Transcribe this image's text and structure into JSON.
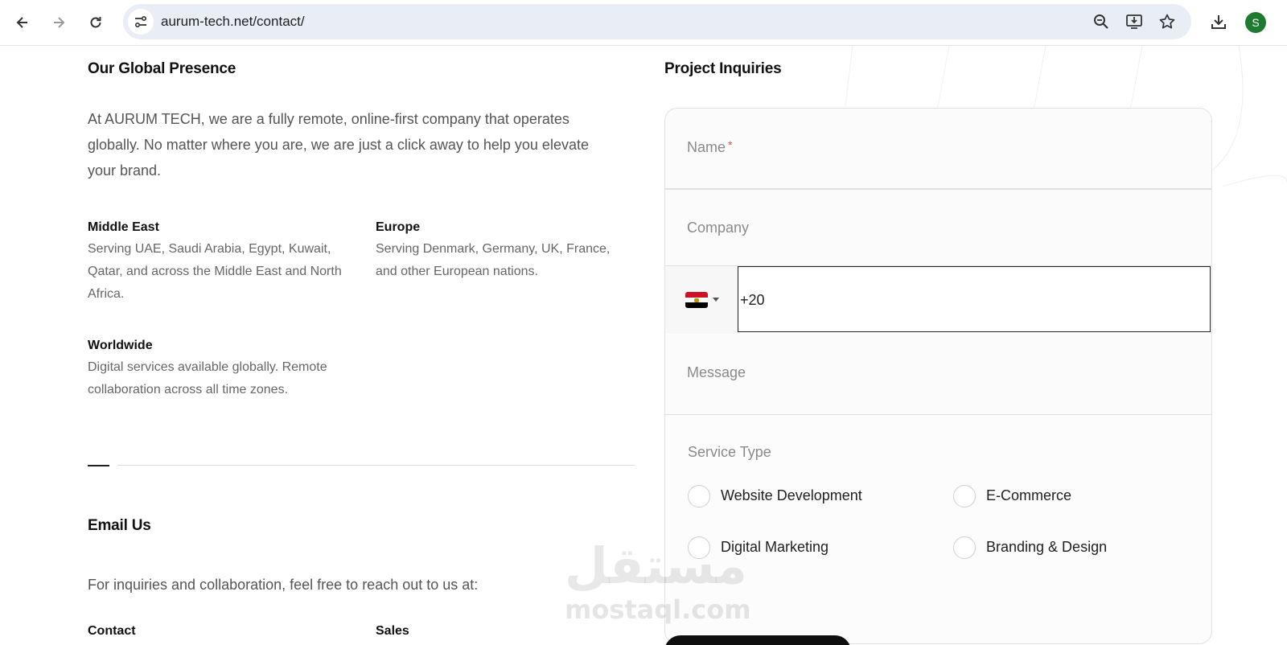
{
  "browser": {
    "url": "aurum-tech.net/contact/",
    "profile_initial": "S",
    "icons": [
      "back-icon",
      "forward-icon",
      "reload-icon",
      "site-info-icon",
      "zoom-icon",
      "install-app-icon",
      "bookmark-star-icon",
      "download-icon"
    ]
  },
  "presence": {
    "title": "Our Global Presence",
    "intro": "At AURUM TECH, we are a fully remote, online-first company that operates globally. No matter where you are, we are just a click away to help you elevate your brand.",
    "regions": [
      {
        "title": "Middle East",
        "text": "Serving UAE, Saudi Arabia, Egypt, Kuwait, Qatar, and across the Middle East and North Africa."
      },
      {
        "title": "Europe",
        "text": "Serving Denmark, Germany, UK, France, and other European nations."
      },
      {
        "title": "Worldwide",
        "text": "Digital services available globally. Remote collaboration across all time zones."
      }
    ]
  },
  "email": {
    "title": "Email Us",
    "intro": "For inquiries and collaboration, feel free to reach out to us at:",
    "contact_label": "Contact",
    "sales_label": "Sales"
  },
  "form": {
    "title": "Project Inquiries",
    "name_label": "Name",
    "required_mark": "*",
    "company_label": "Company",
    "phone_value": "+20",
    "phone_country": "Egypt",
    "message_label": "Message",
    "service_label": "Service Type",
    "services": [
      "Website Development",
      "E-Commerce",
      "Digital Marketing",
      "Branding & Design"
    ]
  },
  "watermark": {
    "arabic": "مستقل",
    "latin": "mostaql.com"
  },
  "colors": {
    "omnibox": "#e9eef6",
    "avatar": "#1e7a2e",
    "required": "#e0564a",
    "button": "#0f0f0f"
  }
}
